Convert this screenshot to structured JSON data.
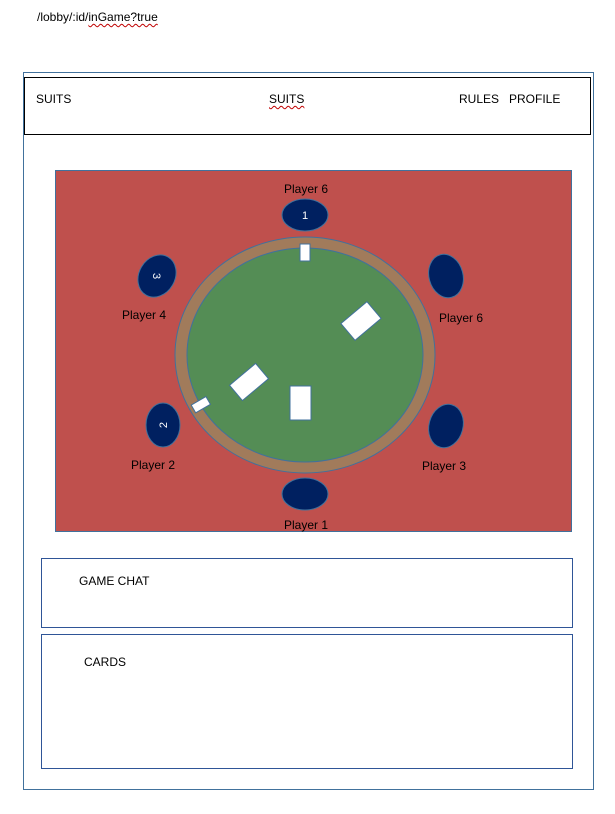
{
  "route": {
    "prefix": "/lobby/:id/",
    "highlighted": "inGame?true"
  },
  "nav": {
    "brand": "SUITS",
    "center": "SUITS",
    "rules": "RULES",
    "profile": "PROFILE"
  },
  "board": {
    "colors": {
      "background": "#bf504d",
      "felt": "#548d55",
      "rim": "#a17b5b",
      "seat": "#002060",
      "card": "#ffffff"
    },
    "seats": [
      {
        "label": "Player 6",
        "number": "1"
      },
      {
        "label": "Player 4",
        "number": "3"
      },
      {
        "label": "Player 6",
        "number": ""
      },
      {
        "label": "Player 2",
        "number": "2"
      },
      {
        "label": "Player 3",
        "number": ""
      },
      {
        "label": "Player 1",
        "number": ""
      }
    ]
  },
  "chat": {
    "title": "GAME CHAT"
  },
  "cards": {
    "title": "CARDS"
  }
}
